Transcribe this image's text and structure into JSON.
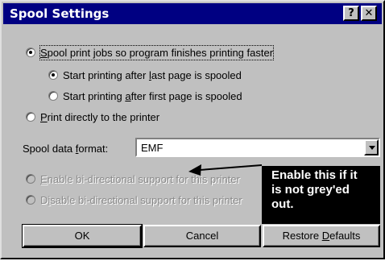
{
  "window": {
    "title": "Spool Settings",
    "help_glyph": "?",
    "close_glyph": "✕"
  },
  "options": {
    "spool": {
      "pre": "",
      "accel": "S",
      "post": "pool print jobs so program finishes printing faster",
      "checked": true
    },
    "start_after_last": {
      "pre": "Start printing after ",
      "accel": "l",
      "post": "ast page is spooled",
      "checked": true
    },
    "start_after_first": {
      "pre": "Start printing ",
      "accel": "a",
      "post": "fter first page is spooled",
      "checked": false
    },
    "print_direct": {
      "pre": "",
      "accel": "P",
      "post": "rint directly to the printer",
      "checked": false
    },
    "enable_bidi": {
      "pre": "",
      "accel": "E",
      "post": "nable bi-directional support for this printer",
      "checked": false,
      "disabled": true
    },
    "disable_bidi": {
      "pre": "D",
      "accel": "i",
      "post": "sable bi-directional support for this printer",
      "checked": false,
      "disabled": true
    }
  },
  "spool_format": {
    "label_pre": "Spool data ",
    "label_accel": "f",
    "label_post": "ormat:",
    "value": "EMF"
  },
  "callout": {
    "line1": "Enable this if it",
    "line2": "is not grey'ed",
    "line3": "out."
  },
  "buttons": {
    "ok": "OK",
    "cancel": "Cancel",
    "restore_pre": "Restore ",
    "restore_accel": "D",
    "restore_post": "efaults"
  },
  "colors": {
    "title_bar": "#000082",
    "dialog_face": "#c0c0c0",
    "callout_bg": "#000000",
    "disabled_text": "#8a8a8a"
  },
  "icons": {
    "dropdown": "chevron-down-icon",
    "arrow": "callout-arrow-icon"
  }
}
